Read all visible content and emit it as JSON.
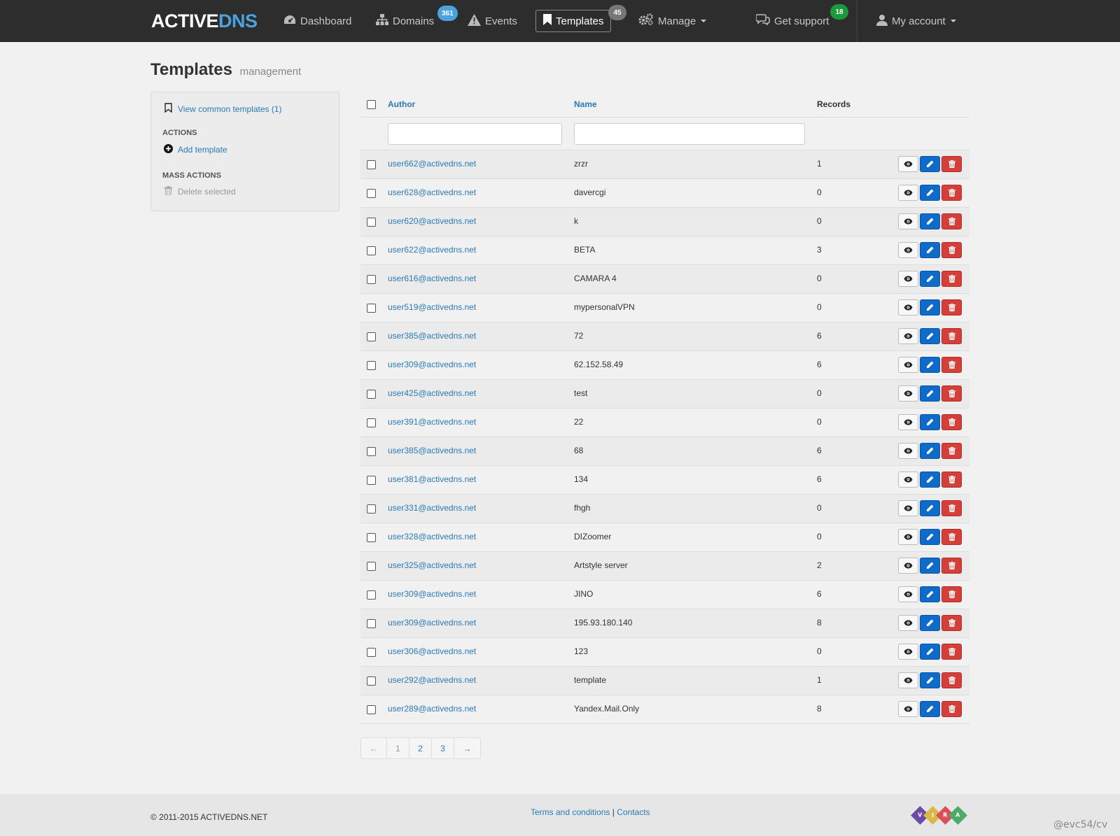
{
  "brand": {
    "part1": "ACTIVE",
    "part2": "DNS"
  },
  "nav": {
    "dashboard": "Dashboard",
    "domains": "Domains",
    "domains_badge": "361",
    "events": "Events",
    "templates": "Templates",
    "templates_badge": "45",
    "manage": "Manage",
    "support": "Get support",
    "support_badge": "18",
    "account": "My account"
  },
  "page": {
    "title": "Templates",
    "subtitle": "management"
  },
  "sidebar": {
    "view_common": "View common templates (1)",
    "actions_heading": "ACTIONS",
    "add_template": "Add template",
    "mass_heading": "MASS ACTIONS",
    "delete_selected": "Delete selected"
  },
  "table": {
    "headers": {
      "author": "Author",
      "name": "Name",
      "records": "Records"
    },
    "rows": [
      {
        "author": "user662@activedns.net",
        "name": "zrzr",
        "records": "1"
      },
      {
        "author": "user628@activedns.net",
        "name": "davercgi",
        "records": "0"
      },
      {
        "author": "user620@activedns.net",
        "name": "k",
        "records": "0"
      },
      {
        "author": "user622@activedns.net",
        "name": "BETA",
        "records": "3"
      },
      {
        "author": "user616@activedns.net",
        "name": "CAMARA 4",
        "records": "0"
      },
      {
        "author": "user519@activedns.net",
        "name": "mypersonalVPN",
        "records": "0"
      },
      {
        "author": "user385@activedns.net",
        "name": "72",
        "records": "6"
      },
      {
        "author": "user309@activedns.net",
        "name": "62.152.58.49",
        "records": "6"
      },
      {
        "author": "user425@activedns.net",
        "name": "test",
        "records": "0"
      },
      {
        "author": "user391@activedns.net",
        "name": "22",
        "records": "0"
      },
      {
        "author": "user385@activedns.net",
        "name": "68",
        "records": "6"
      },
      {
        "author": "user381@activedns.net",
        "name": "134",
        "records": "6"
      },
      {
        "author": "user331@activedns.net",
        "name": "fhgh",
        "records": "0"
      },
      {
        "author": "user328@activedns.net",
        "name": "DIZoomer",
        "records": "0"
      },
      {
        "author": "user325@activedns.net",
        "name": "Artstyle server",
        "records": "2"
      },
      {
        "author": "user309@activedns.net",
        "name": "JINO",
        "records": "6"
      },
      {
        "author": "user309@activedns.net",
        "name": "195.93.180.140",
        "records": "8"
      },
      {
        "author": "user306@activedns.net",
        "name": "123",
        "records": "0"
      },
      {
        "author": "user292@activedns.net",
        "name": "template",
        "records": "1"
      },
      {
        "author": "user289@activedns.net",
        "name": "Yandex.Mail.Only",
        "records": "8"
      }
    ]
  },
  "pagination": {
    "prev": "←",
    "pages": [
      "1",
      "2",
      "3"
    ],
    "next": "→"
  },
  "footer": {
    "copyright": "© 2011-2015 ACTIVEDNS.NET",
    "terms": "Terms and conditions",
    "separator": "|",
    "contacts": "Contacts",
    "vira_letters": [
      "V",
      "I",
      "R",
      "A"
    ],
    "watermark": "@evc54/cv"
  },
  "colors": {
    "navbar": "#2d2d2d",
    "link": "#2a7ab8",
    "domains_badge": "#4aa3df",
    "templates_badge": "#777777",
    "support_badge": "#1a9a3c",
    "edit_button": "#0e6bc9",
    "delete_button": "#d43f3a",
    "vira": [
      "#6a4ba8",
      "#d9b84a",
      "#d8515a",
      "#4cab66"
    ]
  },
  "icons": {
    "dashboard": "tachometer-icon",
    "domains": "sitemap-icon",
    "events": "warning-icon",
    "templates": "bookmark-icon",
    "manage": "cogs-icon",
    "support": "comments-icon",
    "account": "user-icon",
    "row_view": "eye-icon",
    "row_edit": "pencil-icon",
    "row_delete": "trash-icon"
  }
}
